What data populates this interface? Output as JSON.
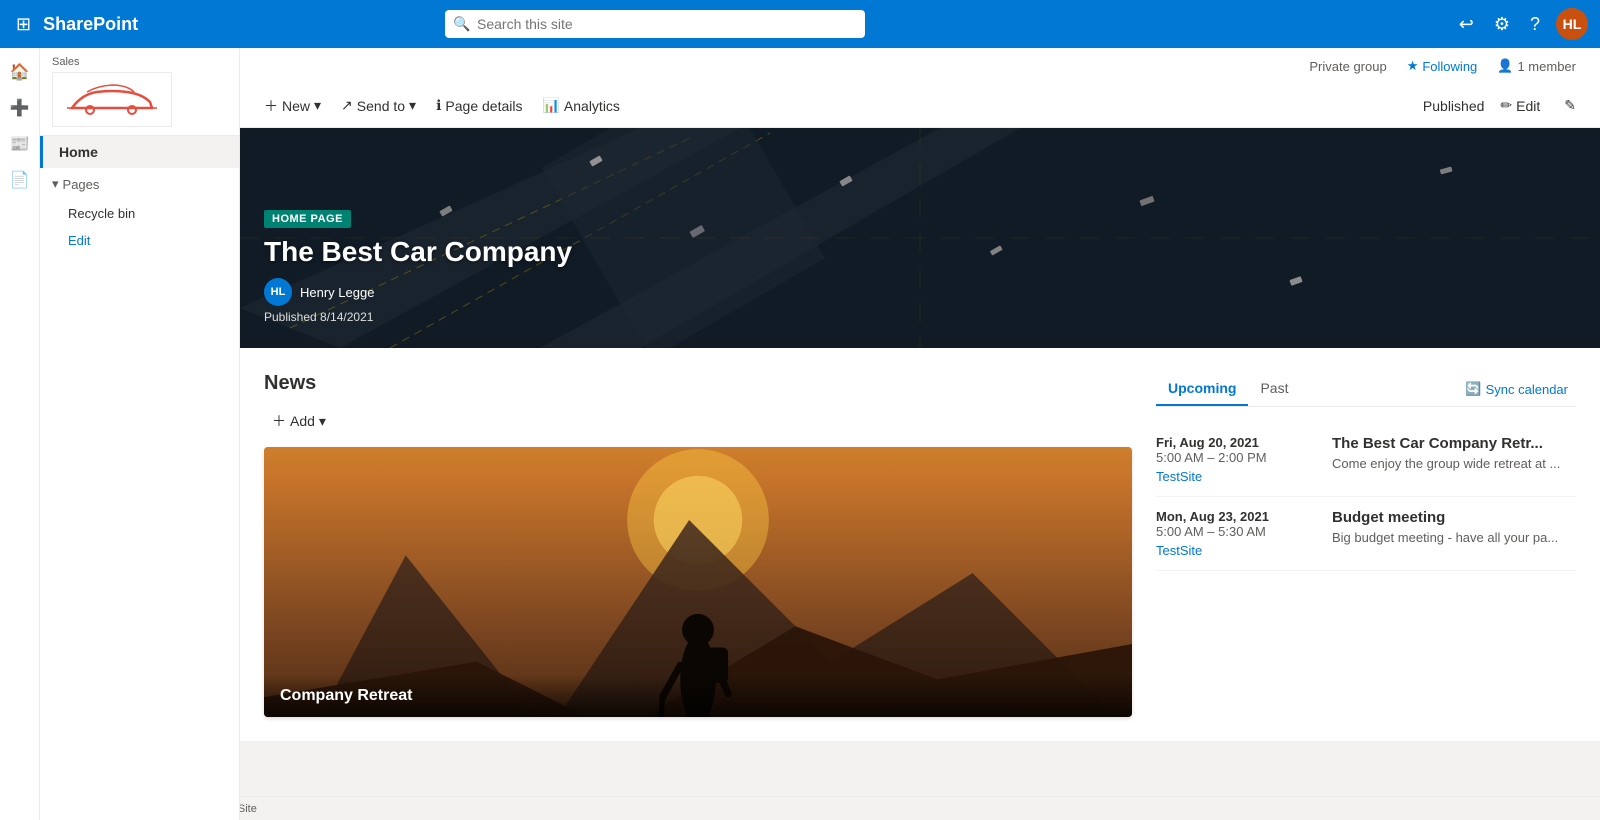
{
  "app": {
    "name": "SharePoint",
    "waffle_icon": "⊞"
  },
  "topnav": {
    "search_placeholder": "Search this site",
    "user_initials": "HL"
  },
  "site_info": {
    "group_type": "Private group",
    "following_label": "Following",
    "members_label": "1 member"
  },
  "page_cmd": {
    "new_label": "New",
    "send_to_label": "Send to",
    "page_details_label": "Page details",
    "analytics_label": "Analytics",
    "published_label": "Published",
    "edit_label": "Edit"
  },
  "sidebar": {
    "logo_label": "Sales",
    "nav_items": [
      {
        "label": "Home",
        "active": true
      }
    ],
    "pages_section": "Pages",
    "subitem_recycle": "Recycle bin",
    "subitem_edit": "Edit"
  },
  "hero": {
    "badge": "HOME PAGE",
    "title": "The Best Car Company",
    "author_initials": "HL",
    "author_name": "Henry Legge",
    "published_text": "Published 8/14/2021"
  },
  "news": {
    "section_title": "News",
    "add_label": "Add",
    "card_title": "Company Retreat"
  },
  "events": {
    "upcoming_tab": "Upcoming",
    "past_tab": "Past",
    "sync_calendar_label": "Sync calendar",
    "items": [
      {
        "date": "Fri, Aug 20, 2021",
        "time": "5:00 AM – 2:00 PM",
        "site_link": "TestSite",
        "title": "The Best Car Company Retr...",
        "description": "Come enjoy the group wide retreat at ..."
      },
      {
        "date": "Mon, Aug 23, 2021",
        "time": "5:00 AM – 5:30 AM",
        "site_link": "TestSite",
        "title": "Budget meeting",
        "description": "Big budget meeting - have all your pa..."
      }
    ]
  },
  "status_bar": {
    "url": "https://citizenbuilders.sharepoint.com/sites/TestSite"
  }
}
